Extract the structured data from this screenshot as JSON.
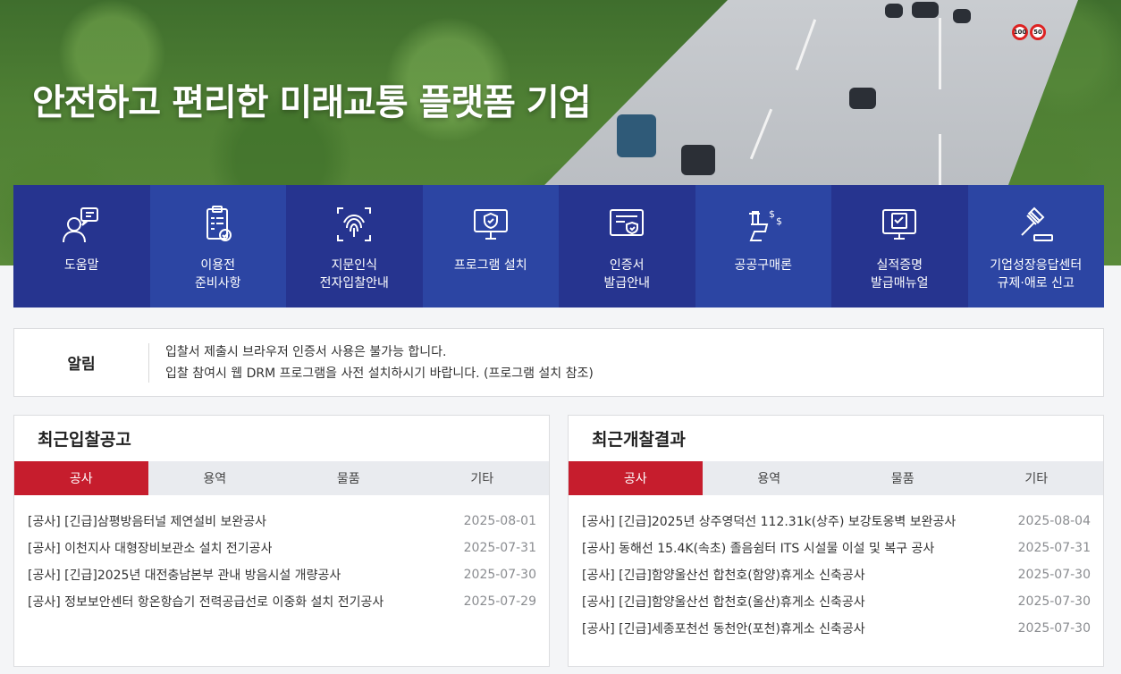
{
  "hero": {
    "title": "안전하고 편리한 미래교통 플랫폼 기업",
    "speed_signs": [
      "100",
      "50"
    ]
  },
  "menu": [
    {
      "label": "도움말",
      "icon": "help-person-icon"
    },
    {
      "label": "이용전\n준비사항",
      "icon": "clipboard-check-icon"
    },
    {
      "label": "지문인식\n전자입찰안내",
      "icon": "fingerprint-icon"
    },
    {
      "label": "프로그램 설치",
      "icon": "monitor-shield-icon"
    },
    {
      "label": "인증서\n발급안내",
      "icon": "certificate-icon"
    },
    {
      "label": "공공구매론",
      "icon": "hand-money-icon"
    },
    {
      "label": "실적증명\n발급매뉴얼",
      "icon": "monitor-document-icon"
    },
    {
      "label": "기업성장응답센터\n규제·애로 신고",
      "icon": "gavel-icon"
    }
  ],
  "notice": {
    "title": "알림",
    "lines": [
      "입찰서 제출시 브라우저 인증서 사용은 불가능 합니다.",
      "입찰 참여시 웹 DRM 프로그램을 사전 설치하시기 바랍니다. (프로그램 설치 참조)"
    ]
  },
  "recent_bids": {
    "title": "최근입찰공고",
    "tabs": [
      "공사",
      "용역",
      "물품",
      "기타"
    ],
    "active_tab": 0,
    "items": [
      {
        "title": "[공사] [긴급]삼평방음터널 제연설비 보완공사",
        "date": "2025-08-01"
      },
      {
        "title": "[공사] 이천지사 대형장비보관소 설치 전기공사",
        "date": "2025-07-31"
      },
      {
        "title": "[공사] [긴급]2025년 대전충남본부 관내 방음시설 개량공사",
        "date": "2025-07-30"
      },
      {
        "title": "[공사] 정보보안센터 항온항습기 전력공급선로 이중화 설치 전기공사",
        "date": "2025-07-29"
      }
    ]
  },
  "recent_results": {
    "title": "최근개찰결과",
    "tabs": [
      "공사",
      "용역",
      "물품",
      "기타"
    ],
    "active_tab": 0,
    "items": [
      {
        "title": "[공사] [긴급]2025년 상주영덕선 112.31k(상주) 보강토옹벽 보완공사",
        "date": "2025-08-04"
      },
      {
        "title": "[공사] 동해선 15.4K(속초) 졸음쉼터 ITS 시설물 이설 및 복구 공사",
        "date": "2025-07-31"
      },
      {
        "title": "[공사] [긴급]함양울산선 합천호(함양)휴게소 신축공사",
        "date": "2025-07-30"
      },
      {
        "title": "[공사] [긴급]함양울산선 합천호(울산)휴게소 신축공사",
        "date": "2025-07-30"
      },
      {
        "title": "[공사] [긴급]세종포천선 동천안(포천)휴게소 신축공사",
        "date": "2025-07-30"
      }
    ]
  },
  "colors": {
    "menu_dark": "#26348f",
    "menu_light": "#2c45a3",
    "tab_active": "#c61d2d",
    "tab_bg": "#e9ebef"
  }
}
